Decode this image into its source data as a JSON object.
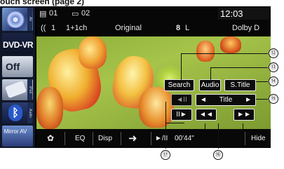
{
  "heading": "ouch screen (page 2)",
  "sources": {
    "av_tab": "AV",
    "dvd_label": "DVD-VR",
    "off_label": "Off",
    "ipod_tab": "iPod",
    "audio_tab": "Audio",
    "mirror_label": "Mirror AV"
  },
  "status": {
    "title_icon": "▤",
    "title_num": "01",
    "chapter_icon": "▭",
    "chapter_num": "02",
    "time": "12:03",
    "audio_lang_icon": "((",
    "audio_lang": "1",
    "channels": "1+1ch",
    "mode": "Original",
    "lr_icon": "8",
    "lr": "L",
    "dolby": "Dolby D"
  },
  "overlay": {
    "search": "Search",
    "audio": "Audio",
    "stitle": "S.Title",
    "step_back": "◄II",
    "title_prev": "◄",
    "title_label": "Title",
    "title_next": "►",
    "step_forward": "II►",
    "rewind": "◄◄",
    "fast_forward": "►►"
  },
  "bottombar": {
    "settings": "✿",
    "eq": "EQ",
    "disp": "Disp",
    "arrow": "➜",
    "play_pause": "►/II",
    "elapsed": "00'44\"",
    "hide": "Hide"
  },
  "callouts": [
    "⑫",
    "⑬",
    "⑭",
    "⑮",
    "⑯",
    "⑰"
  ]
}
